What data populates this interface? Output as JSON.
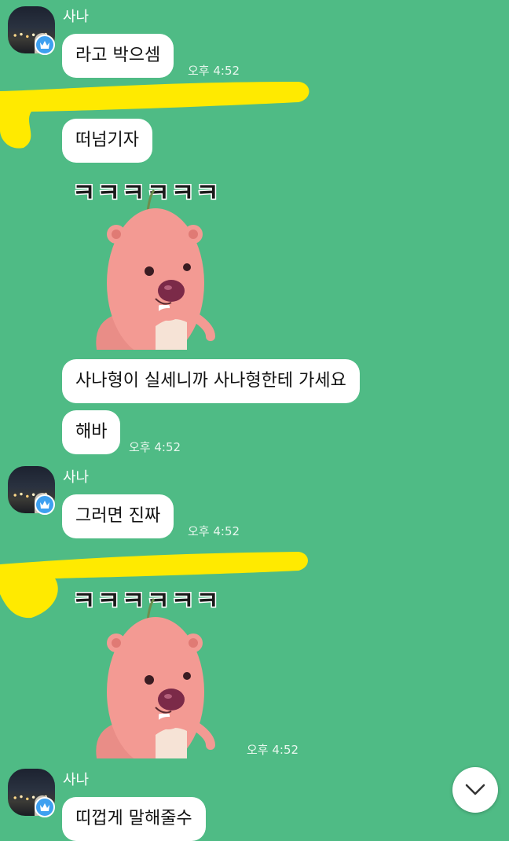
{
  "messages": [
    {
      "sender": "사나",
      "text": "라고 박으셈",
      "time": "오후 4:52"
    },
    {
      "text": "떠넘기자"
    },
    {
      "sticker_text": "ㅋㅋㅋㅋㅋㅋ"
    },
    {
      "text": "사나형이 실세니까 사나형한테 가세요"
    },
    {
      "text": "해바",
      "time": "오후 4:52"
    },
    {
      "sender": "사나",
      "text": "그러면 진짜",
      "time": "오후 4:52"
    },
    {
      "sticker_text": "ㅋㅋㅋㅋㅋㅋ",
      "time": "오후 4:52"
    },
    {
      "sender": "사나",
      "text": "띠껍게 말해줄수"
    }
  ],
  "colors": {
    "background": "#4fbb85",
    "bubble": "#ffffff",
    "highlight": "#ffea00",
    "badge": "#3ea0f0"
  },
  "icons": {
    "badge": "crown-icon",
    "scroll": "chevron-down-icon"
  }
}
